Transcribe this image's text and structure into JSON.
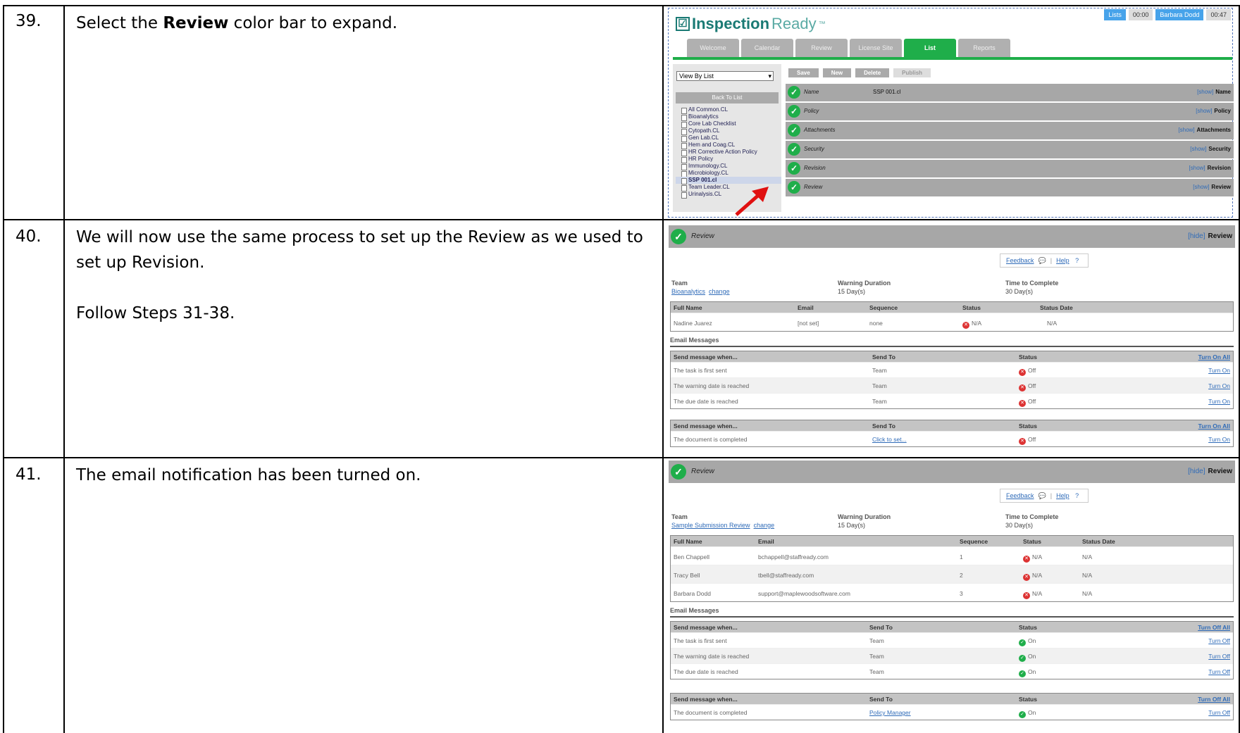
{
  "rows": [
    {
      "number": "39.",
      "text_before": "Select the ",
      "text_bold": "Review",
      "text_after": " color bar to expand."
    },
    {
      "number": "40.",
      "text_1": "We will now use the same process to set up the Review as we used to set up Revision.",
      "text_2": "Follow Steps 31-38."
    },
    {
      "number": "41.",
      "text_1": "The email notification has been turned on."
    }
  ],
  "shot1": {
    "logo_check": "☑",
    "logo_bold": "Inspection",
    "logo_normal": "Ready",
    "logo_tm": "™",
    "stats": [
      "Lists",
      "00:00",
      "Barbara Dodd",
      "00:47"
    ],
    "tabs": [
      "Welcome",
      "Calendar",
      "Review",
      "License Site",
      "List",
      "Reports"
    ],
    "view_select": "View By List",
    "back_button": "Back To List",
    "files": [
      "All Common.CL",
      "Bioanalytics",
      "Core Lab Checklist",
      "Cytopath.CL",
      "Gen Lab.CL",
      "Hem and Coag.CL",
      "HR Corrective Action Policy",
      "HR Policy",
      "Immunology.CL",
      "Microbiology.CL",
      "SSP 001.cl",
      "Team Leader.CL",
      "Urinalysis.CL"
    ],
    "toolbar": [
      "Save",
      "New",
      "Delete",
      "Publish"
    ],
    "bars": [
      {
        "label": "Name",
        "value": "SSP 001.cl",
        "show": "[show]",
        "right": "Name"
      },
      {
        "label": "Policy",
        "value": "",
        "show": "[show]",
        "right": "Policy"
      },
      {
        "label": "Attachments",
        "value": "",
        "show": "[show]",
        "right": "Attachments"
      },
      {
        "label": "Security",
        "value": "",
        "show": "[show]",
        "right": "Security"
      },
      {
        "label": "Revision",
        "value": "",
        "show": "[show]",
        "right": "Revision"
      },
      {
        "label": "Review",
        "value": "",
        "show": "[show]",
        "right": "Review"
      }
    ]
  },
  "shot2": {
    "header_label": "Review",
    "header_hide": "[hide]",
    "header_right": "Review",
    "feedback": "Feedback",
    "help": "Help",
    "team_label": "Team",
    "team_value": "Bioanalytics",
    "team_change": "change",
    "warning_label": "Warning Duration",
    "warning_value": "15 Day(s)",
    "ttc_label": "Time to Complete",
    "ttc_value": "30 Day(s)",
    "people_headers": [
      "Full Name",
      "Email",
      "Sequence",
      "Status",
      "Status Date"
    ],
    "people": [
      {
        "name": "Nadine Juarez",
        "email": "[not set]",
        "sequence": "none",
        "status": "N/A",
        "date": "N/A"
      }
    ],
    "email_messages_label": "Email Messages",
    "msg_headers": [
      "Send message when...",
      "Send To",
      "Status",
      "Turn On All"
    ],
    "messages": [
      {
        "when": "The task is first sent",
        "to": "Team",
        "status": "Off",
        "action": "Turn On"
      },
      {
        "when": "The warning date is reached",
        "to": "Team",
        "status": "Off",
        "action": "Turn On"
      },
      {
        "when": "The due date is reached",
        "to": "Team",
        "status": "Off",
        "action": "Turn On"
      }
    ],
    "msg2_headers": [
      "Send message when...",
      "Send To",
      "Status",
      "Turn On All"
    ],
    "messages2": [
      {
        "when": "The document is completed",
        "to": "Click to set...",
        "status": "Off",
        "action": "Turn On"
      }
    ]
  },
  "shot3": {
    "header_label": "Review",
    "header_hide": "[hide]",
    "header_right": "Review",
    "feedback": "Feedback",
    "help": "Help",
    "team_label": "Team",
    "team_value": "Sample Submission Review",
    "team_change": "change",
    "warning_label": "Warning Duration",
    "warning_value": "15 Day(s)",
    "ttc_label": "Time to Complete",
    "ttc_value": "30 Day(s)",
    "people_headers": [
      "Full Name",
      "Email",
      "Sequence",
      "Status",
      "Status Date"
    ],
    "people": [
      {
        "name": "Ben Chappell",
        "email": "bchappell@staffready.com",
        "sequence": "1",
        "status": "N/A",
        "date": "N/A"
      },
      {
        "name": "Tracy Bell",
        "email": "tbell@staffready.com",
        "sequence": "2",
        "status": "N/A",
        "date": "N/A"
      },
      {
        "name": "Barbara Dodd",
        "email": "support@maplewoodsoftware.com",
        "sequence": "3",
        "status": "N/A",
        "date": "N/A"
      }
    ],
    "email_messages_label": "Email Messages",
    "msg_headers": [
      "Send message when...",
      "Send To",
      "Status",
      "Turn Off All"
    ],
    "messages": [
      {
        "when": "The task is first sent",
        "to": "Team",
        "status": "On",
        "action": "Turn Off"
      },
      {
        "when": "The warning date is reached",
        "to": "Team",
        "status": "On",
        "action": "Turn Off"
      },
      {
        "when": "The due date is reached",
        "to": "Team",
        "status": "On",
        "action": "Turn Off"
      }
    ],
    "msg2_headers": [
      "Send message when...",
      "Send To",
      "Status",
      "Turn Off All"
    ],
    "messages2": [
      {
        "when": "The document is completed",
        "to": "Policy Manager",
        "status": "On",
        "action": "Turn Off"
      }
    ]
  }
}
